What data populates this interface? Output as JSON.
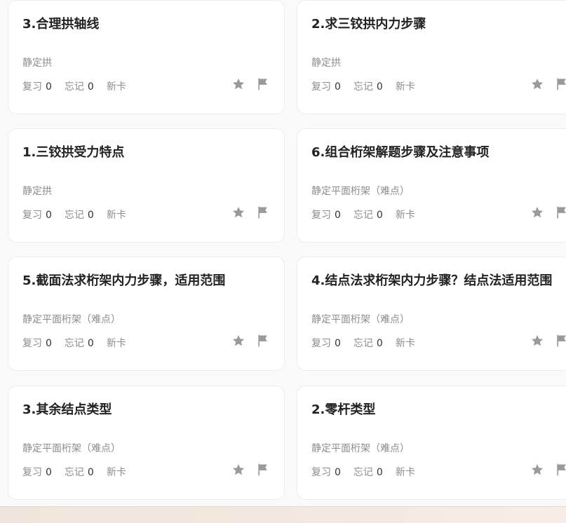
{
  "cards": [
    {
      "title": "3.合理拱轴线",
      "category": "静定拱",
      "review_label": "复习",
      "review_count": "0",
      "forget_label": "忘记",
      "forget_count": "0",
      "new_label": "新卡"
    },
    {
      "title": "2.求三铰拱内力步骤",
      "category": "静定拱",
      "review_label": "复习",
      "review_count": "0",
      "forget_label": "忘记",
      "forget_count": "0",
      "new_label": "新卡"
    },
    {
      "title": "1.三铰拱受力特点",
      "category": "静定拱",
      "review_label": "复习",
      "review_count": "0",
      "forget_label": "忘记",
      "forget_count": "0",
      "new_label": "新卡"
    },
    {
      "title": "6.组合桁架解题步骤及注意事项",
      "category": "静定平面桁架（难点）",
      "review_label": "复习",
      "review_count": "0",
      "forget_label": "忘记",
      "forget_count": "0",
      "new_label": "新卡"
    },
    {
      "title": "5.截面法求桁架内力步骤，适用范围",
      "category": "静定平面桁架（难点）",
      "review_label": "复习",
      "review_count": "0",
      "forget_label": "忘记",
      "forget_count": "0",
      "new_label": "新卡"
    },
    {
      "title": "4.结点法求桁架内力步骤？结点法适用范围",
      "category": "静定平面桁架（难点）",
      "review_label": "复习",
      "review_count": "0",
      "forget_label": "忘记",
      "forget_count": "0",
      "new_label": "新卡"
    },
    {
      "title": "3.其余结点类型",
      "category": "静定平面桁架（难点）",
      "review_label": "复习",
      "review_count": "0",
      "forget_label": "忘记",
      "forget_count": "0",
      "new_label": "新卡"
    },
    {
      "title": "2.零杆类型",
      "category": "静定平面桁架（难点）",
      "review_label": "复习",
      "review_count": "0",
      "forget_label": "忘记",
      "forget_count": "0",
      "new_label": "新卡"
    }
  ],
  "icons": {
    "favorite": "star-icon",
    "flag": "flag-icon"
  },
  "colors": {
    "icon": "#9a9a9a",
    "title": "#222222",
    "muted": "#8c8c8c"
  }
}
